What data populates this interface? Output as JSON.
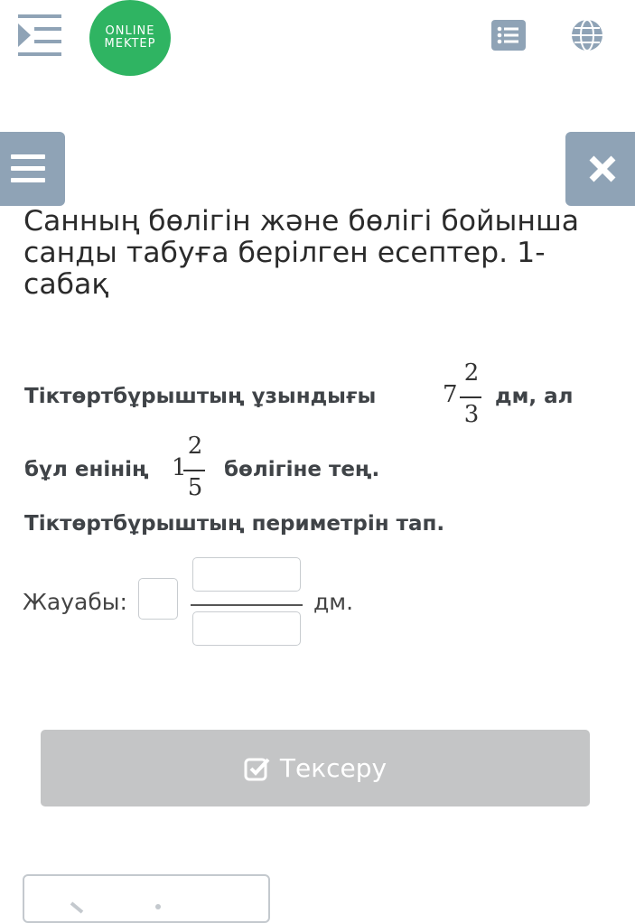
{
  "header": {
    "logo_line1": "ONLINE",
    "logo_line2": "MEKTEP",
    "brand_color": "#2fb462"
  },
  "page_title": "Санның бөлігін және бөлігі бойынша санды табуға берілген есептер. 1-сабақ",
  "question": {
    "line1_prefix": "Тіктөртбұрыштың ұзындығы",
    "frac1": {
      "whole": "7",
      "num": "2",
      "den": "3"
    },
    "line1_suffix": "дм, ал",
    "line2_prefix": "бұл енінің",
    "frac2": {
      "whole": "1",
      "num": "2",
      "den": "5"
    },
    "line2_suffix": "бөлігіне тең.",
    "line3": "Тіктөртбұрыштың периметрін тап."
  },
  "answer": {
    "label": "Жауабы:",
    "whole_value": "",
    "numerator_value": "",
    "denominator_value": "",
    "unit": "дм."
  },
  "check_button": {
    "label": "Тексеру"
  },
  "colors": {
    "side_button": "#8fa3b6",
    "check_disabled": "#c4c5c6"
  }
}
